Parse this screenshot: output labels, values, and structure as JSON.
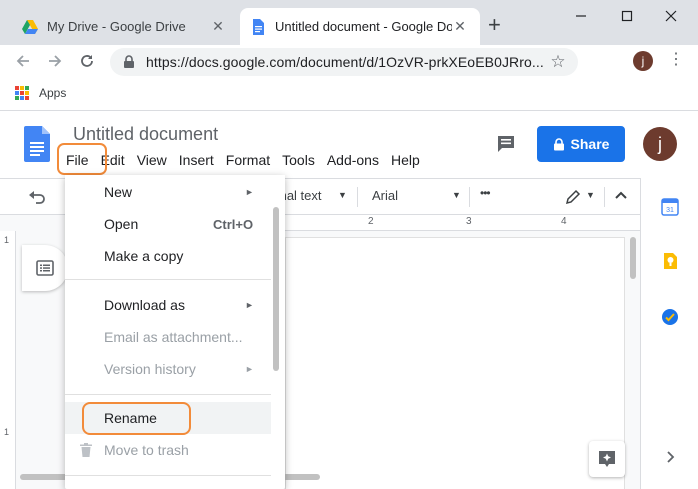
{
  "browser": {
    "tabs": [
      {
        "title": "My Drive - Google Drive",
        "active": false
      },
      {
        "title": "Untitled document - Google Docs",
        "active": true
      }
    ],
    "new_tab_symbol": "+",
    "url": "https://docs.google.com/document/d/1OzVR-prkXEoEB0JRro...",
    "profile_initial": "j",
    "bookmarks": {
      "apps_label": "Apps"
    }
  },
  "docs": {
    "title": "Untitled document",
    "menu": [
      "File",
      "Edit",
      "View",
      "Insert",
      "Format",
      "Tools",
      "Add-ons",
      "Help"
    ],
    "share_label": "Share",
    "avatar_initial": "j",
    "toolbar": {
      "style_label": "Normal text",
      "style_visible": "mal text",
      "font_label": "Arial",
      "more_symbol": "•••"
    },
    "ruler_numbers": [
      "2",
      "3",
      "4"
    ],
    "vruler_numbers": [
      "1",
      "1"
    ]
  },
  "file_menu": {
    "items": [
      {
        "label": "New",
        "submenu": true,
        "disabled": false
      },
      {
        "label": "Open",
        "shortcut": "Ctrl+O",
        "disabled": false
      },
      {
        "label": "Make a copy",
        "disabled": false
      },
      {
        "label": "Download as",
        "submenu": true,
        "disabled": false
      },
      {
        "label": "Email as attachment...",
        "disabled": true
      },
      {
        "label": "Version history",
        "submenu": true,
        "disabled": true
      },
      {
        "label": "Rename",
        "disabled": false,
        "highlighted": true
      },
      {
        "label": "Move to trash",
        "disabled": true
      }
    ]
  },
  "colors": {
    "accent": "#1a73e8",
    "highlight_annotation": "#f28b3a",
    "avatar": "#6d3b2e"
  }
}
